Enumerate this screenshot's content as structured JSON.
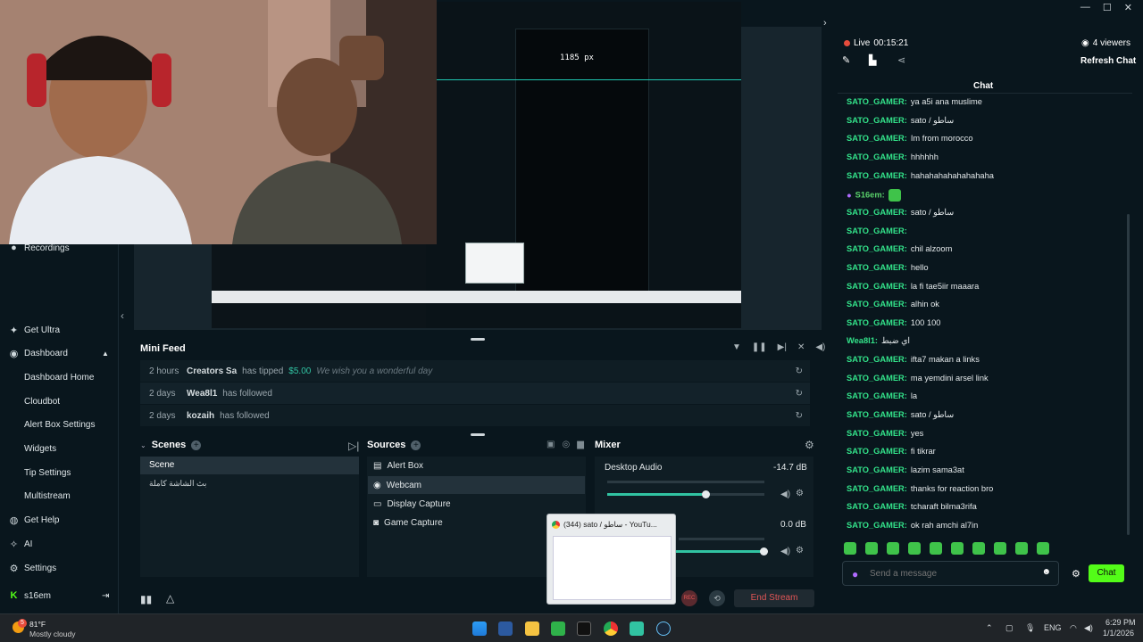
{
  "window": {
    "min": "—",
    "max": "☐",
    "close": "✕"
  },
  "nav": {
    "recordings": "Recordings",
    "get_ultra": "Get Ultra",
    "dashboard": "Dashboard",
    "subitems": [
      "Dashboard Home",
      "Cloudbot",
      "Alert Box Settings",
      "Widgets",
      "Tip Settings",
      "Multistream"
    ],
    "get_help": "Get Help",
    "ai": "AI",
    "settings": "Settings",
    "user": "s16em"
  },
  "preview": {
    "measure": "1185 px"
  },
  "mini_feed": {
    "title": "Mini Feed",
    "rows": [
      {
        "time": "2 hours",
        "user": "Creators Sa",
        "action": "has tipped",
        "amount": "$5.00",
        "message": "We wish you a wonderful day"
      },
      {
        "time": "2 days",
        "user": "Wea8l1",
        "action": "has followed"
      },
      {
        "time": "2 days",
        "user": "kozaih",
        "action": "has followed"
      }
    ]
  },
  "scenes": {
    "title": "Scenes",
    "items": [
      "Scene",
      "بث الشاشة كاملة"
    ]
  },
  "sources": {
    "title": "Sources",
    "items": [
      {
        "icon": "alert-box-icon",
        "label": "Alert Box"
      },
      {
        "icon": "webcam-icon",
        "label": "Webcam"
      },
      {
        "icon": "display-capture-icon",
        "label": "Display Capture"
      },
      {
        "icon": "game-capture-icon",
        "label": "Game Capture"
      }
    ]
  },
  "mixer": {
    "title": "Mixer",
    "channels": [
      {
        "name": "Desktop Audio",
        "db": "-14.7 dB",
        "level": 0.6
      },
      {
        "name": "",
        "db": "0.0 dB",
        "level": 0.98
      }
    ]
  },
  "footer": {
    "end_stream": "End Stream"
  },
  "tooltip": {
    "title": "(344) sato / ساطو - YouTu..."
  },
  "chat": {
    "live_label": "Live",
    "live_time": "00:15:21",
    "viewers": "4 viewers",
    "refresh": "Refresh Chat",
    "title": "Chat",
    "messages": [
      {
        "user": "SATO_GAMER:",
        "text": "ya a5i ana muslime"
      },
      {
        "user": "SATO_GAMER:",
        "text": "sato / ساطو"
      },
      {
        "user": "SATO_GAMER:",
        "text": "Im from morocco"
      },
      {
        "user": "SATO_GAMER:",
        "text": "hhhhhh"
      },
      {
        "user": "SATO_GAMER:",
        "text": "hahahahahahahahaha"
      },
      {
        "user": "S16em:",
        "text": ""
      },
      {
        "user": "SATO_GAMER:",
        "text": "sato / ساطو"
      },
      {
        "user": "SATO_GAMER:",
        "text": ""
      },
      {
        "user": "SATO_GAMER:",
        "text": "chil alzoom"
      },
      {
        "user": "SATO_GAMER:",
        "text": "hello"
      },
      {
        "user": "SATO_GAMER:",
        "text": "la fi tae5iir maaara"
      },
      {
        "user": "SATO_GAMER:",
        "text": "alhin ok"
      },
      {
        "user": "SATO_GAMER:",
        "text": "100 100"
      },
      {
        "user": "Wea8l1:",
        "text": "اي ضبط"
      },
      {
        "user": "SATO_GAMER:",
        "text": "ifta7 makan a links"
      },
      {
        "user": "SATO_GAMER:",
        "text": "ma yemdini arsel link"
      },
      {
        "user": "SATO_GAMER:",
        "text": "la"
      },
      {
        "user": "SATO_GAMER:",
        "text": "sato / ساطو"
      },
      {
        "user": "SATO_GAMER:",
        "text": "yes"
      },
      {
        "user": "SATO_GAMER:",
        "text": "fi tikrar"
      },
      {
        "user": "SATO_GAMER:",
        "text": "lazim sama3at"
      },
      {
        "user": "SATO_GAMER:",
        "text": "thanks for reaction bro"
      },
      {
        "user": "SATO_GAMER:",
        "text": "tcharaft bilma3rifa"
      },
      {
        "user": "SATO_GAMER:",
        "text": "ok rah amchi al7in"
      }
    ],
    "placeholder": "Send a message",
    "send": "Chat"
  },
  "taskbar": {
    "weather_temp": "81°F",
    "weather_desc": "Mostly cloudy",
    "badge": "5",
    "lang": "ENG",
    "time": "6:29 PM",
    "date": "1/1/2026"
  },
  "colors": {
    "accent": "#31c3a2",
    "live": "#e74c3c",
    "chat_user": "#33e38a",
    "end_stream": "#e25656"
  }
}
